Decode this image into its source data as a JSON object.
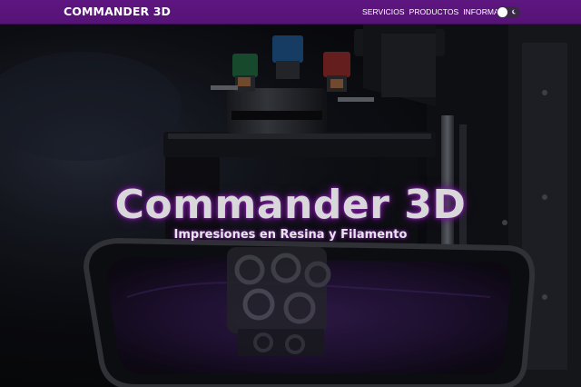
{
  "navbar": {
    "brand": "COMMANDER 3D",
    "links": [
      "SERVICIOS",
      "PRODUCTOS",
      "INFORMACIÓN"
    ],
    "theme_toggle_icon": "moon-icon",
    "accent_color": "#5e1680"
  },
  "hero": {
    "title": "Commander 3D",
    "subtitle": "Impresiones en Resina y Filamento",
    "background_image": "resin 3D printer with printed lattice object",
    "glow_color": "#7a2a9a"
  }
}
